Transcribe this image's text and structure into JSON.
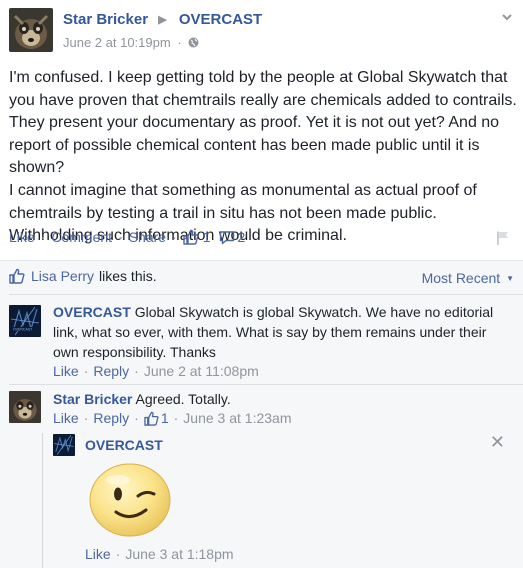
{
  "post": {
    "author": "Star Bricker",
    "target": "OVERCAST",
    "date": "June 2 at 10:19pm",
    "separator": "·",
    "paragraphs": [
      "I'm confused. I keep getting told by the people at Global Skywatch that you have proven that chemtrails really are chemicals added to contrails. They present your documentary as proof. Yet it is not out yet? And no report of possible chemical content has been made public until it is shown?",
      "I cannot imagine that something as monumental as actual proof of chemtrails by testing a trail in situ has not been made public. Withholding such information would be criminal."
    ],
    "actions": {
      "like": "Like",
      "comment": "Comment",
      "share": "Share",
      "like_count": "1",
      "comment_count": "2"
    },
    "likes": {
      "name": "Lisa Perry",
      "rest": "likes this."
    },
    "sort_label": "Most Recent"
  },
  "comments": [
    {
      "author": "OVERCAST",
      "text": "Global Skywatch is global Skywatch. We have no editorial link, what so ever, with them. What is say by them remains under their own responsibility. Thanks",
      "like": "Like",
      "reply": "Reply",
      "time": "June 2 at 11:08pm"
    },
    {
      "author": "Star Bricker",
      "text": "Agreed. Totally.",
      "like": "Like",
      "reply": "Reply",
      "like_count": "1",
      "time": "June 3 at 1:23am"
    }
  ],
  "reply": {
    "author": "OVERCAST",
    "like": "Like",
    "time": "June 3 at 1:18pm",
    "sticker": "wink-smiley-sticker"
  },
  "icons": {
    "globe": "globe-icon",
    "chevron": "chevron-down-icon",
    "thumbs_up": "thumbs-up-icon",
    "comment_bubble": "comment-bubble-icon",
    "flag": "flag-icon",
    "close": "close-icon"
  },
  "colors": {
    "link": "#4b67a1",
    "name": "#365899",
    "meta": "#90949c",
    "text": "#1d2129",
    "comments_bg": "#f6f7f9"
  }
}
